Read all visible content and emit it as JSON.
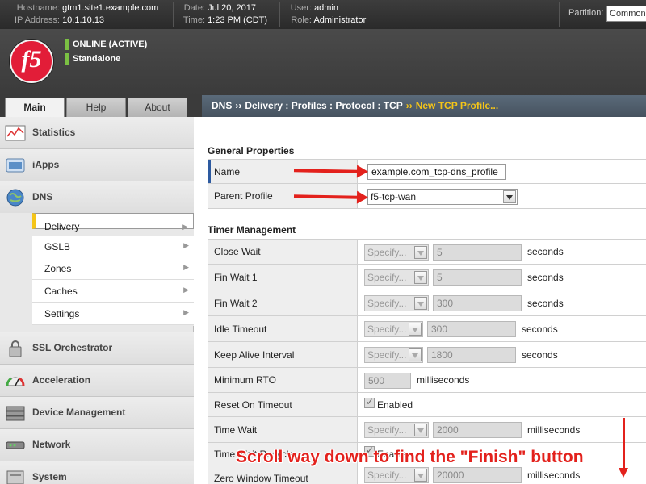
{
  "topbar": {
    "hostname_label": "Hostname:",
    "hostname": "gtm1.site1.example.com",
    "ip_label": "IP Address:",
    "ip": "10.1.10.13",
    "date_label": "Date:",
    "date": "Jul 20, 2017",
    "time_label": "Time:",
    "time": "1:23 PM (CDT)",
    "user_label": "User:",
    "user": "admin",
    "role_label": "Role:",
    "role": "Administrator",
    "partition_label": "Partition:",
    "partition_value": "Common"
  },
  "brand": {
    "logo_text": "f5",
    "status_primary": "ONLINE (ACTIVE)",
    "status_secondary": "Standalone",
    "status_color": "#7bc043"
  },
  "tabs": [
    {
      "label": "Main",
      "active": true
    },
    {
      "label": "Help",
      "active": false
    },
    {
      "label": "About",
      "active": false
    }
  ],
  "breadcrumb": {
    "parts": [
      "DNS",
      "Delivery : Profiles : Protocol : TCP"
    ],
    "separator": "››",
    "current": "New TCP Profile..."
  },
  "sidebar": {
    "sections": [
      {
        "label": "Statistics",
        "icon": "statistics-icon"
      },
      {
        "label": "iApps",
        "icon": "iapps-icon"
      },
      {
        "label": "DNS",
        "icon": "globe-icon"
      },
      {
        "label": "SSL Orchestrator",
        "icon": "lock-icon"
      },
      {
        "label": "Acceleration",
        "icon": "gauge-icon"
      },
      {
        "label": "Device Management",
        "icon": "server-icon"
      },
      {
        "label": "Network",
        "icon": "network-icon"
      },
      {
        "label": "System",
        "icon": "system-icon"
      }
    ],
    "dns_subitems": [
      {
        "label": "Delivery",
        "selected": true
      },
      {
        "label": "GSLB",
        "selected": false
      },
      {
        "label": "Zones",
        "selected": false
      },
      {
        "label": "Caches",
        "selected": false
      },
      {
        "label": "Settings",
        "selected": false
      }
    ]
  },
  "general": {
    "title": "General Properties",
    "name_label": "Name",
    "name_value": "example.com_tcp-dns_profile",
    "parent_label": "Parent Profile",
    "parent_value": "f5-tcp-wan"
  },
  "timer": {
    "title": "Timer Management",
    "specify": "Specify...",
    "rows": [
      {
        "label": "Close Wait",
        "value": "5",
        "unit": "seconds"
      },
      {
        "label": "Fin Wait 1",
        "value": "5",
        "unit": "seconds"
      },
      {
        "label": "Fin Wait 2",
        "value": "300",
        "unit": "seconds"
      },
      {
        "label": "Idle Timeout",
        "value": "300",
        "unit": "seconds"
      },
      {
        "label": "Keep Alive Interval",
        "value": "1800",
        "unit": "seconds"
      },
      {
        "label": "Minimum RTO",
        "value": "500",
        "unit": "milliseconds"
      },
      {
        "label": "Reset On Timeout",
        "value": "Enabled"
      },
      {
        "label": "Time Wait",
        "value": "2000",
        "unit": "milliseconds"
      },
      {
        "label": "Time Wait Recycle",
        "value": "Enable"
      },
      {
        "label": "Zero Window Timeout",
        "value": "20000",
        "unit": "milliseconds"
      }
    ]
  },
  "annotation": {
    "callout": "Scroll way down to find the \"Finish\" button",
    "color": "#e3211c"
  }
}
